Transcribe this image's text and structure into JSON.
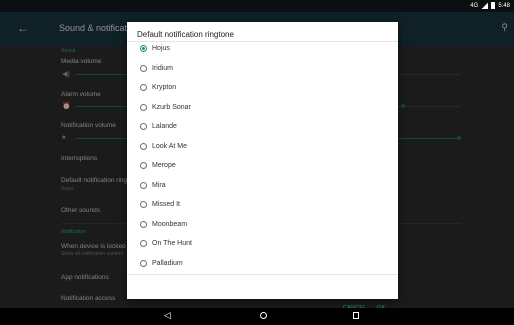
{
  "status_bar": {
    "network_badge": "4G",
    "time": "5:48"
  },
  "app_bar": {
    "title": "Sound & notification"
  },
  "settings": {
    "sound_section": "Sound",
    "media_volume": "Media volume",
    "alarm_volume": "Alarm volume",
    "notification_volume": "Notification volume",
    "interruptions": "Interruptions",
    "default_ringtone": {
      "title": "Default notification ringtone",
      "value": "Hojus"
    },
    "other_sounds": "Other sounds",
    "notification_section": "Notification",
    "when_locked": {
      "title": "When device is locked",
      "value": "Show all notification content"
    },
    "app_notifications": "App notifications",
    "notification_access": "Notification access"
  },
  "dialog": {
    "title": "Default notification ringtone",
    "selected": "Hojus",
    "options": [
      "Hojus",
      "Iridium",
      "Krypton",
      "Kzurb Sonar",
      "Lalande",
      "Look At Me",
      "Merope",
      "Mira",
      "Missed It",
      "Moonbeam",
      "On The Hunt",
      "Palladium"
    ],
    "cancel_label": "CANCEL",
    "ok_label": "OK"
  },
  "colors": {
    "accent": "#1e8e82",
    "app_bar": "#17323c",
    "dialog_bg": "#ffffff"
  },
  "icons": {
    "back": "back-arrow-icon",
    "search": "search-icon",
    "home": "home-icon",
    "recents": "recents-icon"
  }
}
